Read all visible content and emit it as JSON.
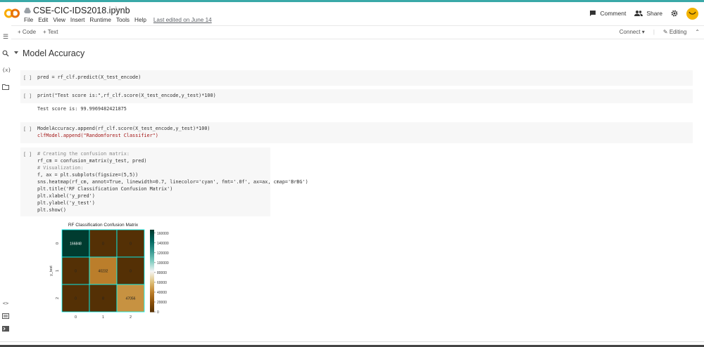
{
  "app": {
    "title": "CSE-CIC-IDS2018.ipynb",
    "last_edited": "Last edited on June 14",
    "menu": [
      "File",
      "Edit",
      "View",
      "Insert",
      "Runtime",
      "Tools",
      "Help"
    ],
    "logo_text": "CO",
    "accent_color": "#3aa9a8",
    "logo_color": "#f9ab00"
  },
  "header_actions": {
    "comment": "Comment",
    "share": "Share"
  },
  "toolbar": {
    "add_code": "+ Code",
    "add_text": "+ Text",
    "connect": "Connect",
    "editing": "Editing"
  },
  "section": {
    "title": "Model Accuracy"
  },
  "cells": [
    {
      "run": "[ ]",
      "code": "pred = rf_clf.predict(X_test_encode)"
    },
    {
      "run": "[ ]",
      "code": "print(\"Test score is:\",rf_clf.score(X_test_encode,y_test)*100)",
      "output": "Test score is: 99.9969482421875"
    },
    {
      "run": "[ ]",
      "code_line1": "ModelAccuracy.append(rf_clf.score(X_test_encode,y_test)*100)",
      "code_line2": "clfModel.append(\"Randomforest Classifier\")"
    },
    {
      "run": "[ ]",
      "lines": [
        "# Creating the confusion matrix:",
        "rf_cm = confusion_matrix(y_test, pred)",
        "# Visualization:",
        "f, ax = plt.subplots(figsize=(5,5))",
        "sns.heatmap(rf_cm, annot=True, linewidth=0.7, linecolor='cyan', fmt='.0f', ax=ax, cmap='BrBG')",
        "plt.title('RF Classification Confusion Matrix')",
        "plt.xlabel('y_pred')",
        "plt.ylabel('y_test')",
        "plt.show()"
      ]
    }
  ],
  "chart_data": {
    "type": "heatmap",
    "title": "RF Classification Confusion Matrix",
    "xlabel": "",
    "ylabel": "y_test",
    "x_ticks": [
      "0",
      "1",
      "2"
    ],
    "y_ticks": [
      "0",
      "1",
      "2"
    ],
    "matrix": [
      [
        166848,
        0,
        0
      ],
      [
        0,
        40232,
        0
      ],
      [
        0,
        8,
        47056
      ]
    ],
    "colorbar_ticks": [
      "160000",
      "140000",
      "120000",
      "100000",
      "80000",
      "60000",
      "40000",
      "20000",
      "0"
    ],
    "colorbar_range": [
      0,
      166848
    ],
    "cmap": "BrBG",
    "linecolor": "#00ffff"
  }
}
